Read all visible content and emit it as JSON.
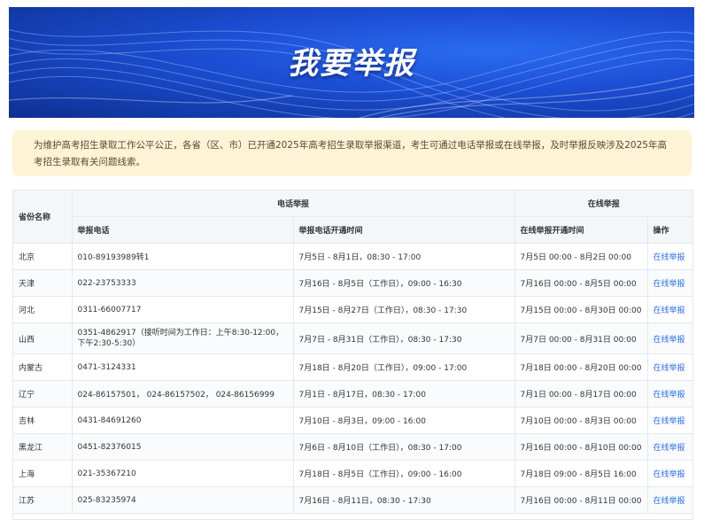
{
  "banner": {
    "title": "我要举报"
  },
  "notice": {
    "text": "为维护高考招生录取工作公平公正，各省（区、市）已开通2025年高考招生录取举报渠道，考生可通过电话举报或在线举报，及时举报反映涉及2025年高考招生录取有关问题线索。"
  },
  "table": {
    "headers": {
      "province": "省份名称",
      "phone_group": "电话举报",
      "online_group": "在线举报",
      "phone": "举报电话",
      "phone_time": "举报电话开通时间",
      "online_time": "在线举报开通时间",
      "action": "操作"
    },
    "rows": [
      {
        "province": "北京",
        "phone": "010-89193989转1",
        "phone_time": "7月5日 - 8月1日，08:30 - 17:00",
        "online_time": "7月5日 00:00 - 8月2日 00:00",
        "action": "在线举报"
      },
      {
        "province": "天津",
        "phone": "022-23753333",
        "phone_time": "7月16日 - 8月5日（工作日），09:00 - 16:30",
        "online_time": "7月16日 00:00 - 8月5日 00:00",
        "action": "在线举报"
      },
      {
        "province": "河北",
        "phone": "0311-66007717",
        "phone_time": "7月15日 - 8月27日（工作日），08:30 - 17:30",
        "online_time": "7月15日 00:00 - 8月30日 00:00",
        "action": "在线举报"
      },
      {
        "province": "山西",
        "phone": "0351-4862917（接听时间为工作日：上午8:30-12:00，下午2:30-5:30）",
        "phone_time": "7月7日 - 8月31日（工作日），08:30 - 17:30",
        "online_time": "7月7日 00:00 - 8月31日 00:00",
        "action": "在线举报"
      },
      {
        "province": "内蒙古",
        "phone": "0471-3124331",
        "phone_time": "7月18日 - 8月20日（工作日），09:00 - 17:00",
        "online_time": "7月18日 00:00 - 8月20日 00:00",
        "action": "在线举报"
      },
      {
        "province": "辽宁",
        "phone": "024-86157501， 024-86157502， 024-86156999",
        "phone_time": "7月1日 - 8月17日，08:30 - 17:00",
        "online_time": "7月1日 00:00 - 8月17日 00:00",
        "action": "在线举报"
      },
      {
        "province": "吉林",
        "phone": "0431-84691260",
        "phone_time": "7月10日 - 8月3日，09:00 - 16:00",
        "online_time": "7月10日 00:00 - 8月3日 00:00",
        "action": "在线举报"
      },
      {
        "province": "黑龙江",
        "phone": "0451-82376015",
        "phone_time": "7月6日 - 8月10日（工作日），08:30 - 17:00",
        "online_time": "7月16日 00:00 - 8月10日 00:00",
        "action": "在线举报"
      },
      {
        "province": "上海",
        "phone": "021-35367210",
        "phone_time": "7月18日 - 8月5日（工作日），09:00 - 16:00",
        "online_time": "7月18日 09:00 - 8月5日 16:00",
        "action": "在线举报"
      },
      {
        "province": "江苏",
        "phone": "025-83235974",
        "phone_time": "7月16日 - 8月11日，08:30 - 17:30",
        "online_time": "7月16日 00:00 - 8月11日 00:00",
        "action": "在线举报"
      }
    ]
  }
}
